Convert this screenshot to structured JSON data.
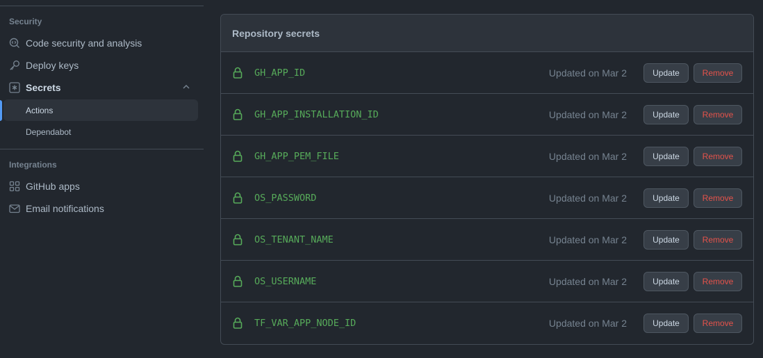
{
  "sidebar": {
    "security_heading": "Security",
    "items": [
      {
        "label": "Code security and analysis",
        "icon": "codescan-icon"
      },
      {
        "label": "Deploy keys",
        "icon": "key-icon"
      },
      {
        "label": "Secrets",
        "icon": "asterisk-box-icon",
        "expanded": true
      }
    ],
    "secrets_sub": [
      {
        "label": "Actions",
        "active": true
      },
      {
        "label": "Dependabot",
        "active": false
      }
    ],
    "integrations_heading": "Integrations",
    "integration_items": [
      {
        "label": "GitHub apps",
        "icon": "apps-icon"
      },
      {
        "label": "Email notifications",
        "icon": "mail-icon"
      }
    ]
  },
  "panel": {
    "title": "Repository secrets",
    "update_label": "Update",
    "remove_label": "Remove",
    "secrets": [
      {
        "name": "GH_APP_ID",
        "updated": "Updated on Mar 2"
      },
      {
        "name": "GH_APP_INSTALLATION_ID",
        "updated": "Updated on Mar 2"
      },
      {
        "name": "GH_APP_PEM_FILE",
        "updated": "Updated on Mar 2"
      },
      {
        "name": "OS_PASSWORD",
        "updated": "Updated on Mar 2"
      },
      {
        "name": "OS_TENANT_NAME",
        "updated": "Updated on Mar 2"
      },
      {
        "name": "OS_USERNAME",
        "updated": "Updated on Mar 2"
      },
      {
        "name": "TF_VAR_APP_NODE_ID",
        "updated": "Updated on Mar 2"
      }
    ]
  },
  "colors": {
    "background": "#22272e",
    "accent_green": "#57ab5a",
    "danger_red": "#e5534b",
    "active_blue": "#539bf5"
  }
}
